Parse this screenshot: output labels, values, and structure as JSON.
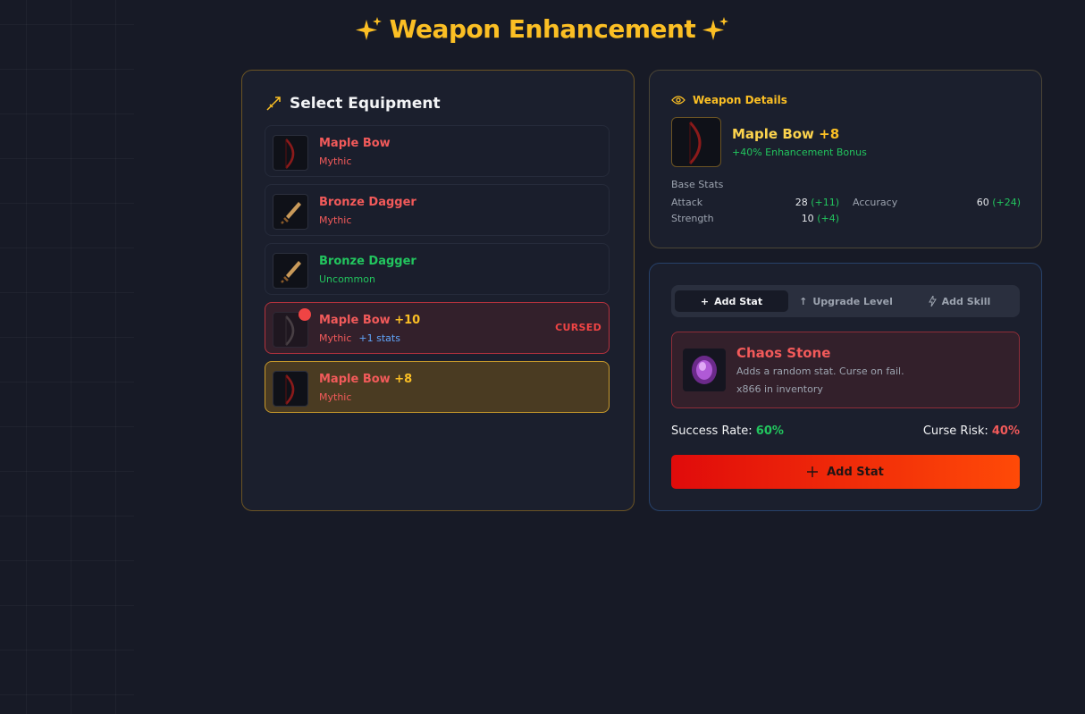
{
  "page": {
    "title": "Weapon Enhancement"
  },
  "equipment": {
    "title": "Select Equipment",
    "items": [
      {
        "name": "Maple Bow",
        "level": "",
        "rarity": "Mythic",
        "extra": "",
        "status": ""
      },
      {
        "name": "Bronze Dagger",
        "level": "",
        "rarity": "Mythic",
        "extra": "",
        "status": ""
      },
      {
        "name": "Bronze Dagger",
        "level": "",
        "rarity": "Uncommon",
        "extra": "",
        "status": ""
      },
      {
        "name": "Maple Bow",
        "level": "+10",
        "rarity": "Mythic",
        "extra": "+1 stats",
        "status": "CURSED"
      },
      {
        "name": "Maple Bow",
        "level": "+8",
        "rarity": "Mythic",
        "extra": "",
        "status": ""
      }
    ]
  },
  "details": {
    "heading": "Weapon Details",
    "name": "Maple Bow",
    "level": "+8",
    "bonus": "+40% Enhancement Bonus",
    "base_label": "Base Stats",
    "stats": [
      {
        "label": "Attack",
        "value": "28",
        "bonus": "(+11)"
      },
      {
        "label": "Accuracy",
        "value": "60",
        "bonus": "(+24)"
      },
      {
        "label": "Strength",
        "value": "10",
        "bonus": "(+4)"
      }
    ]
  },
  "actions": {
    "tabs": [
      {
        "label": "Add Stat",
        "icon": "plus-icon"
      },
      {
        "label": "Upgrade Level",
        "icon": "arrow-up-icon"
      },
      {
        "label": "Add Skill",
        "icon": "lightning-icon"
      }
    ],
    "stone": {
      "name": "Chaos Stone",
      "description": "Adds a random stat. Curse on fail.",
      "inventory": "x866 in inventory"
    },
    "success_label": "Success Rate:",
    "success_value": "60%",
    "curse_label": "Curse Risk:",
    "curse_value": "40%",
    "button_label": "Add Stat"
  },
  "colors": {
    "accent": "#fbbf24",
    "mythic": "#f25a5a",
    "uncommon": "#22c55e",
    "button_start": "#e00b0b",
    "button_end": "#ff4a07"
  }
}
